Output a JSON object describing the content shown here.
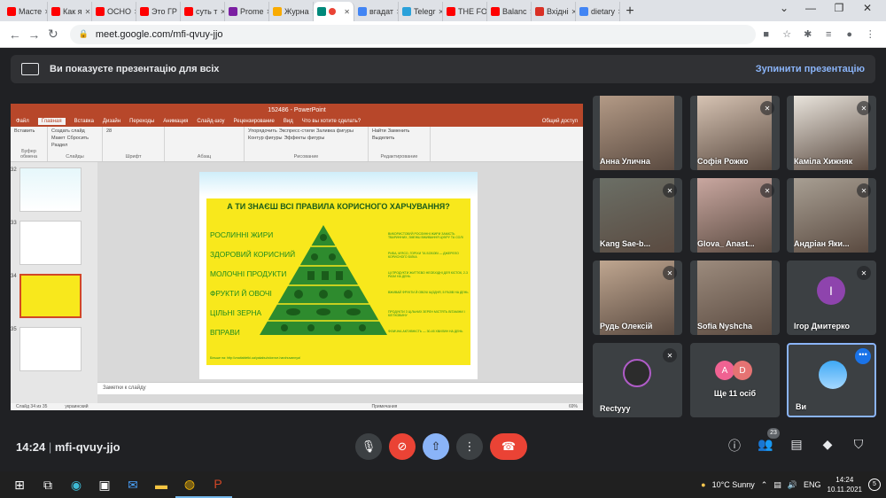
{
  "browser": {
    "tabs": [
      {
        "label": "Масте",
        "color": "#ff0000"
      },
      {
        "label": "Как я",
        "color": "#ff0000"
      },
      {
        "label": "ОСНО",
        "color": "#ff0000"
      },
      {
        "label": "Это ГР",
        "color": "#ff0000"
      },
      {
        "label": "суть т",
        "color": "#ff0000"
      },
      {
        "label": "Prome",
        "color": "#7b1fa2"
      },
      {
        "label": "Журна",
        "color": "#f9ab00"
      },
      {
        "label": "",
        "color": "#00897b",
        "active": true
      },
      {
        "label": "вгадат",
        "color": "#4285f4"
      },
      {
        "label": "Telegr",
        "color": "#2aa1da"
      },
      {
        "label": "THE FO",
        "color": "#ff0000"
      },
      {
        "label": "Balanc",
        "color": "#ff0000"
      },
      {
        "label": "Вхідні",
        "color": "#d93025"
      },
      {
        "label": "dietary",
        "color": "#4285f4"
      }
    ],
    "url": "meet.google.com/mfi-qvuy-jjo"
  },
  "banner": {
    "text": "Ви показуєте презентацію для всіх",
    "stop": "Зупинити презентацію"
  },
  "ppt": {
    "title": "152486 - PowerPoint",
    "menu": [
      "Файл",
      "Главная",
      "Вставка",
      "Дизайн",
      "Переходы",
      "Анимация",
      "Слайд-шоу",
      "Рецензирование",
      "Вид",
      "Что вы хотите сделать?"
    ],
    "share": "Общий доступ",
    "groups": [
      {
        "label": "Буфер обмена",
        "items": [
          "Вставить"
        ]
      },
      {
        "label": "Слайды",
        "items": [
          "Создать слайд",
          "Макет",
          "Сбросить",
          "Раздел"
        ]
      },
      {
        "label": "Шрифт",
        "items": [
          "28"
        ]
      },
      {
        "label": "Абзац",
        "items": [
          ""
        ]
      },
      {
        "label": "Рисование",
        "items": [
          "Упорядочить",
          "Экспресс-стили",
          "Заливка фигуры",
          "Контур фигуры",
          "Эффекты фигуры"
        ]
      },
      {
        "label": "Редактирование",
        "items": [
          "Найти",
          "Заменить",
          "Выделить"
        ]
      }
    ],
    "thumbs": [
      "32",
      "33",
      "34",
      "35"
    ],
    "notes": "Заметки к слайду",
    "status": {
      "slide": "Слайд 34 из 35",
      "lang": "украинский",
      "notes": "Примечания",
      "zoom": "69%"
    }
  },
  "slide": {
    "title": "А ТИ ЗНАЄШ ВСІ ПРАВИЛА КОРИСНОГО ХАРЧУВАННЯ?",
    "labels": [
      "РОСЛИННІ ЖИРИ",
      "ЗДОРОВИЙ КОРИСНИЙ",
      "МОЛОЧНІ ПРОДУКТИ",
      "ФРУКТИ Й ОВОЧІ",
      "ЦІЛЬНІ ЗЕРНА",
      "ВПРАВИ"
    ],
    "tips": [
      "ВИКОРИСТОВУЙ РОСЛИННІ ЖИРИ ЗАМІСТЬ ТВАРИННИХ, ЗМЕНШ ВЖИВАННЯ ЦУКРУ ТА СОЛІ",
      "РИБА, М'ЯСО, ГОРІХИ ТА БОБОВІ — ДЖЕРЕЛО КОРИСНОГО БІЛКА",
      "ЦІ ПРОДУКТИ ЖИТТЄВО НЕОБХІДНІ ДЛЯ КІСТОК, 2-3 РАЗИ НА ДЕНЬ",
      "ВЖИВАЙ ФРУКТИ Й ОВОЧІ ЩОДНЯ, 5 РАЗІВ НА ДЕНЬ",
      "ПРОДУКТИ З ЦІЛЬНИХ ЗЕРЕН МІСТЯТЬ ВІТАМІНИ І КЛІТКОВИНУ",
      "ФІЗИЧНА АКТИВНІСТЬ — 30-45 ХВИЛИН НА ДЕНЬ"
    ],
    "link": "Більше на: http://znaitabletki.ua/yakabu/zdorove-harchuvannya/"
  },
  "participants": [
    {
      "name": "Анна Улична",
      "muted": false
    },
    {
      "name": "Софія Рожко",
      "muted": true
    },
    {
      "name": "Каміла Хижняк",
      "muted": true
    },
    {
      "name": "Kang Sae-b...",
      "muted": true
    },
    {
      "name": "Glova_ Anast...",
      "muted": true
    },
    {
      "name": "Андріан Яки...",
      "muted": true
    },
    {
      "name": "Рудь Олексій",
      "muted": true
    },
    {
      "name": "Sofia Nyshcha",
      "muted": false
    },
    {
      "name": "Ігор Дмитерко",
      "muted": true,
      "initial": "І"
    },
    {
      "name": "Rectyyy",
      "muted": true
    },
    {
      "name": "Ще 11 осіб",
      "muted": false,
      "initials": [
        "A",
        "D"
      ]
    },
    {
      "name": "Ви",
      "muted": false,
      "more": "•••"
    }
  ],
  "meeting": {
    "time": "14:24",
    "code": "mfi-qvuy-jjo",
    "count": "23"
  },
  "taskbar": {
    "weather": "10°C  Sunny",
    "lang": "ENG",
    "time": "14:24",
    "date": "10.11.2021",
    "notif": "5"
  },
  "colors": {
    "meet_bg": "#202124",
    "accent": "#8ab4f8",
    "end_call": "#ea4335",
    "ppt_red": "#b7472a",
    "slide_yellow": "#f8e81c",
    "slide_green": "#1e8b1e"
  }
}
